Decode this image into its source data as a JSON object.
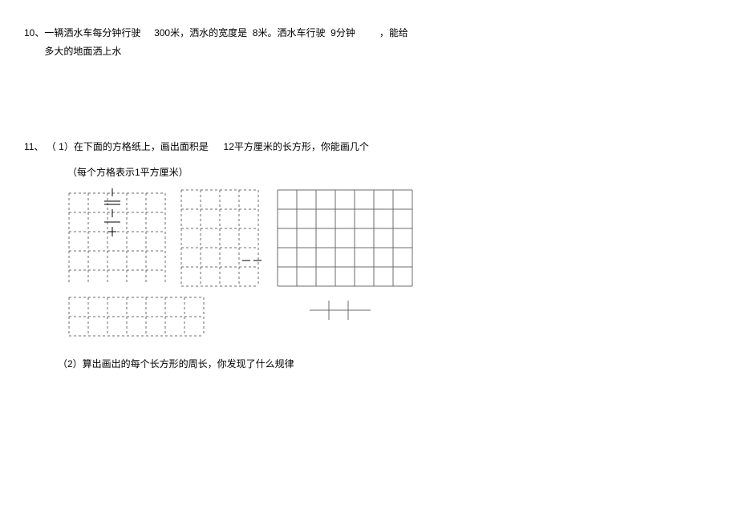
{
  "q10": {
    "number": "10、",
    "segments": {
      "a": "一辆洒水车每分钟行驶",
      "b": "300米，洒水的宽度是",
      "c": "8米。洒水车行驶",
      "d": "9分钟",
      "e": "，能给"
    },
    "line2": "多大的地面洒上水"
  },
  "q11": {
    "number": "11、",
    "part1_prefix": "（ 1）在下面的方格纸上，画出面积是",
    "part1_value": "12平方厘米的长方形，你能画几个",
    "sub_note": "（每个方格表示1平方厘米）",
    "part2": "（2）算出画出的每个长方形的周长，你发现了什么规律"
  },
  "grid": {
    "cell": 24
  }
}
